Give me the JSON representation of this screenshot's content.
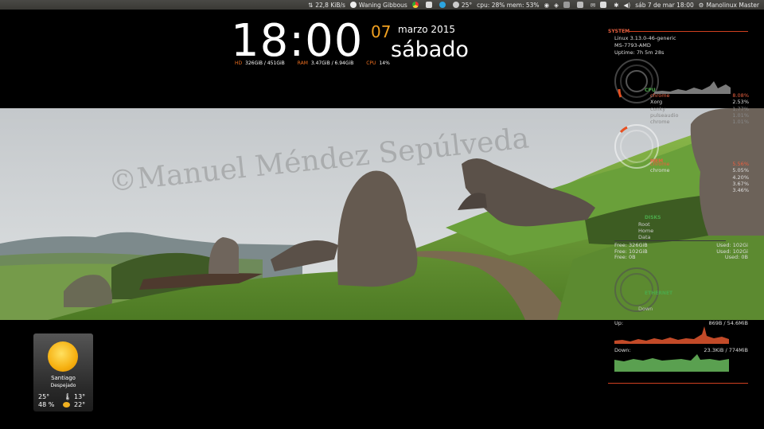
{
  "topbar": {
    "net_speed": "22,8 KiB/s",
    "moon": "Waning Gibbous",
    "temp": "25°",
    "cpu_mem": "cpu: 28% mem: 53%",
    "datetime": "sáb 7 de mar 18:00",
    "user": "Manolinux Master"
  },
  "clock": {
    "time": "18:00",
    "day": "07",
    "month_year": "marzo 2015",
    "weekday": "sábado"
  },
  "stats": {
    "hd_label": "HD",
    "hd_value": "326GiB / 451GiB",
    "ram_label": "RAM",
    "ram_value": "3.47GiB / 6.94GiB",
    "cpu_label": "CPU",
    "cpu_value": "14%"
  },
  "watermark": "©Manuel Méndez Sepúlveda",
  "conky": {
    "system_title": "SYSTEM",
    "kernel": "Linux 3.13.0-46-generic",
    "host": "MS-7793-AMD",
    "uptime": "Uptime: 7h 5m 28s",
    "cpu_title": "CPU",
    "cpu_procs": [
      {
        "name": "chrome",
        "value": "8.08%"
      },
      {
        "name": "Xorg",
        "value": "2.53%"
      },
      {
        "name": "conky",
        "value": "1.77%"
      },
      {
        "name": "pulseaudio",
        "value": "1.01%"
      },
      {
        "name": "chrome",
        "value": "1.01%"
      }
    ],
    "mem_title": "MEM",
    "mem_procs": [
      {
        "name": "chrome",
        "value": "5.56%"
      },
      {
        "name": "chrome",
        "value": "5.05%"
      },
      {
        "name": "",
        "value": "4.20%"
      },
      {
        "name": "",
        "value": "3.67%"
      },
      {
        "name": "",
        "value": "3.46%"
      }
    ],
    "disks_title": "DISKS",
    "disk_names": [
      "Root",
      "Home",
      "Data"
    ],
    "disk_rows": [
      {
        "free": "Free: 326GiB",
        "used": "Used: 102Gi"
      },
      {
        "free": "Free: 102GiB",
        "used": "Used: 102Gi"
      },
      {
        "free": "Free: 0B",
        "used": "Used: 0B"
      }
    ],
    "net_title": "ETHERNET",
    "net_sub": "Down",
    "up_label": "Up:",
    "up_value": "869B / 54.6MiB",
    "down_label": "Down:",
    "down_value": "23.3KiB / 774MiB"
  },
  "weather": {
    "city": "Santiago",
    "condition": "Despejado",
    "temp_now": "25°",
    "humidity": "48 %",
    "temp_high": "13°",
    "temp_low": "22°"
  },
  "colors": {
    "accent": "#f07020",
    "rule": "#d04020",
    "clock": "#ffffff",
    "day": "#f0a020"
  }
}
